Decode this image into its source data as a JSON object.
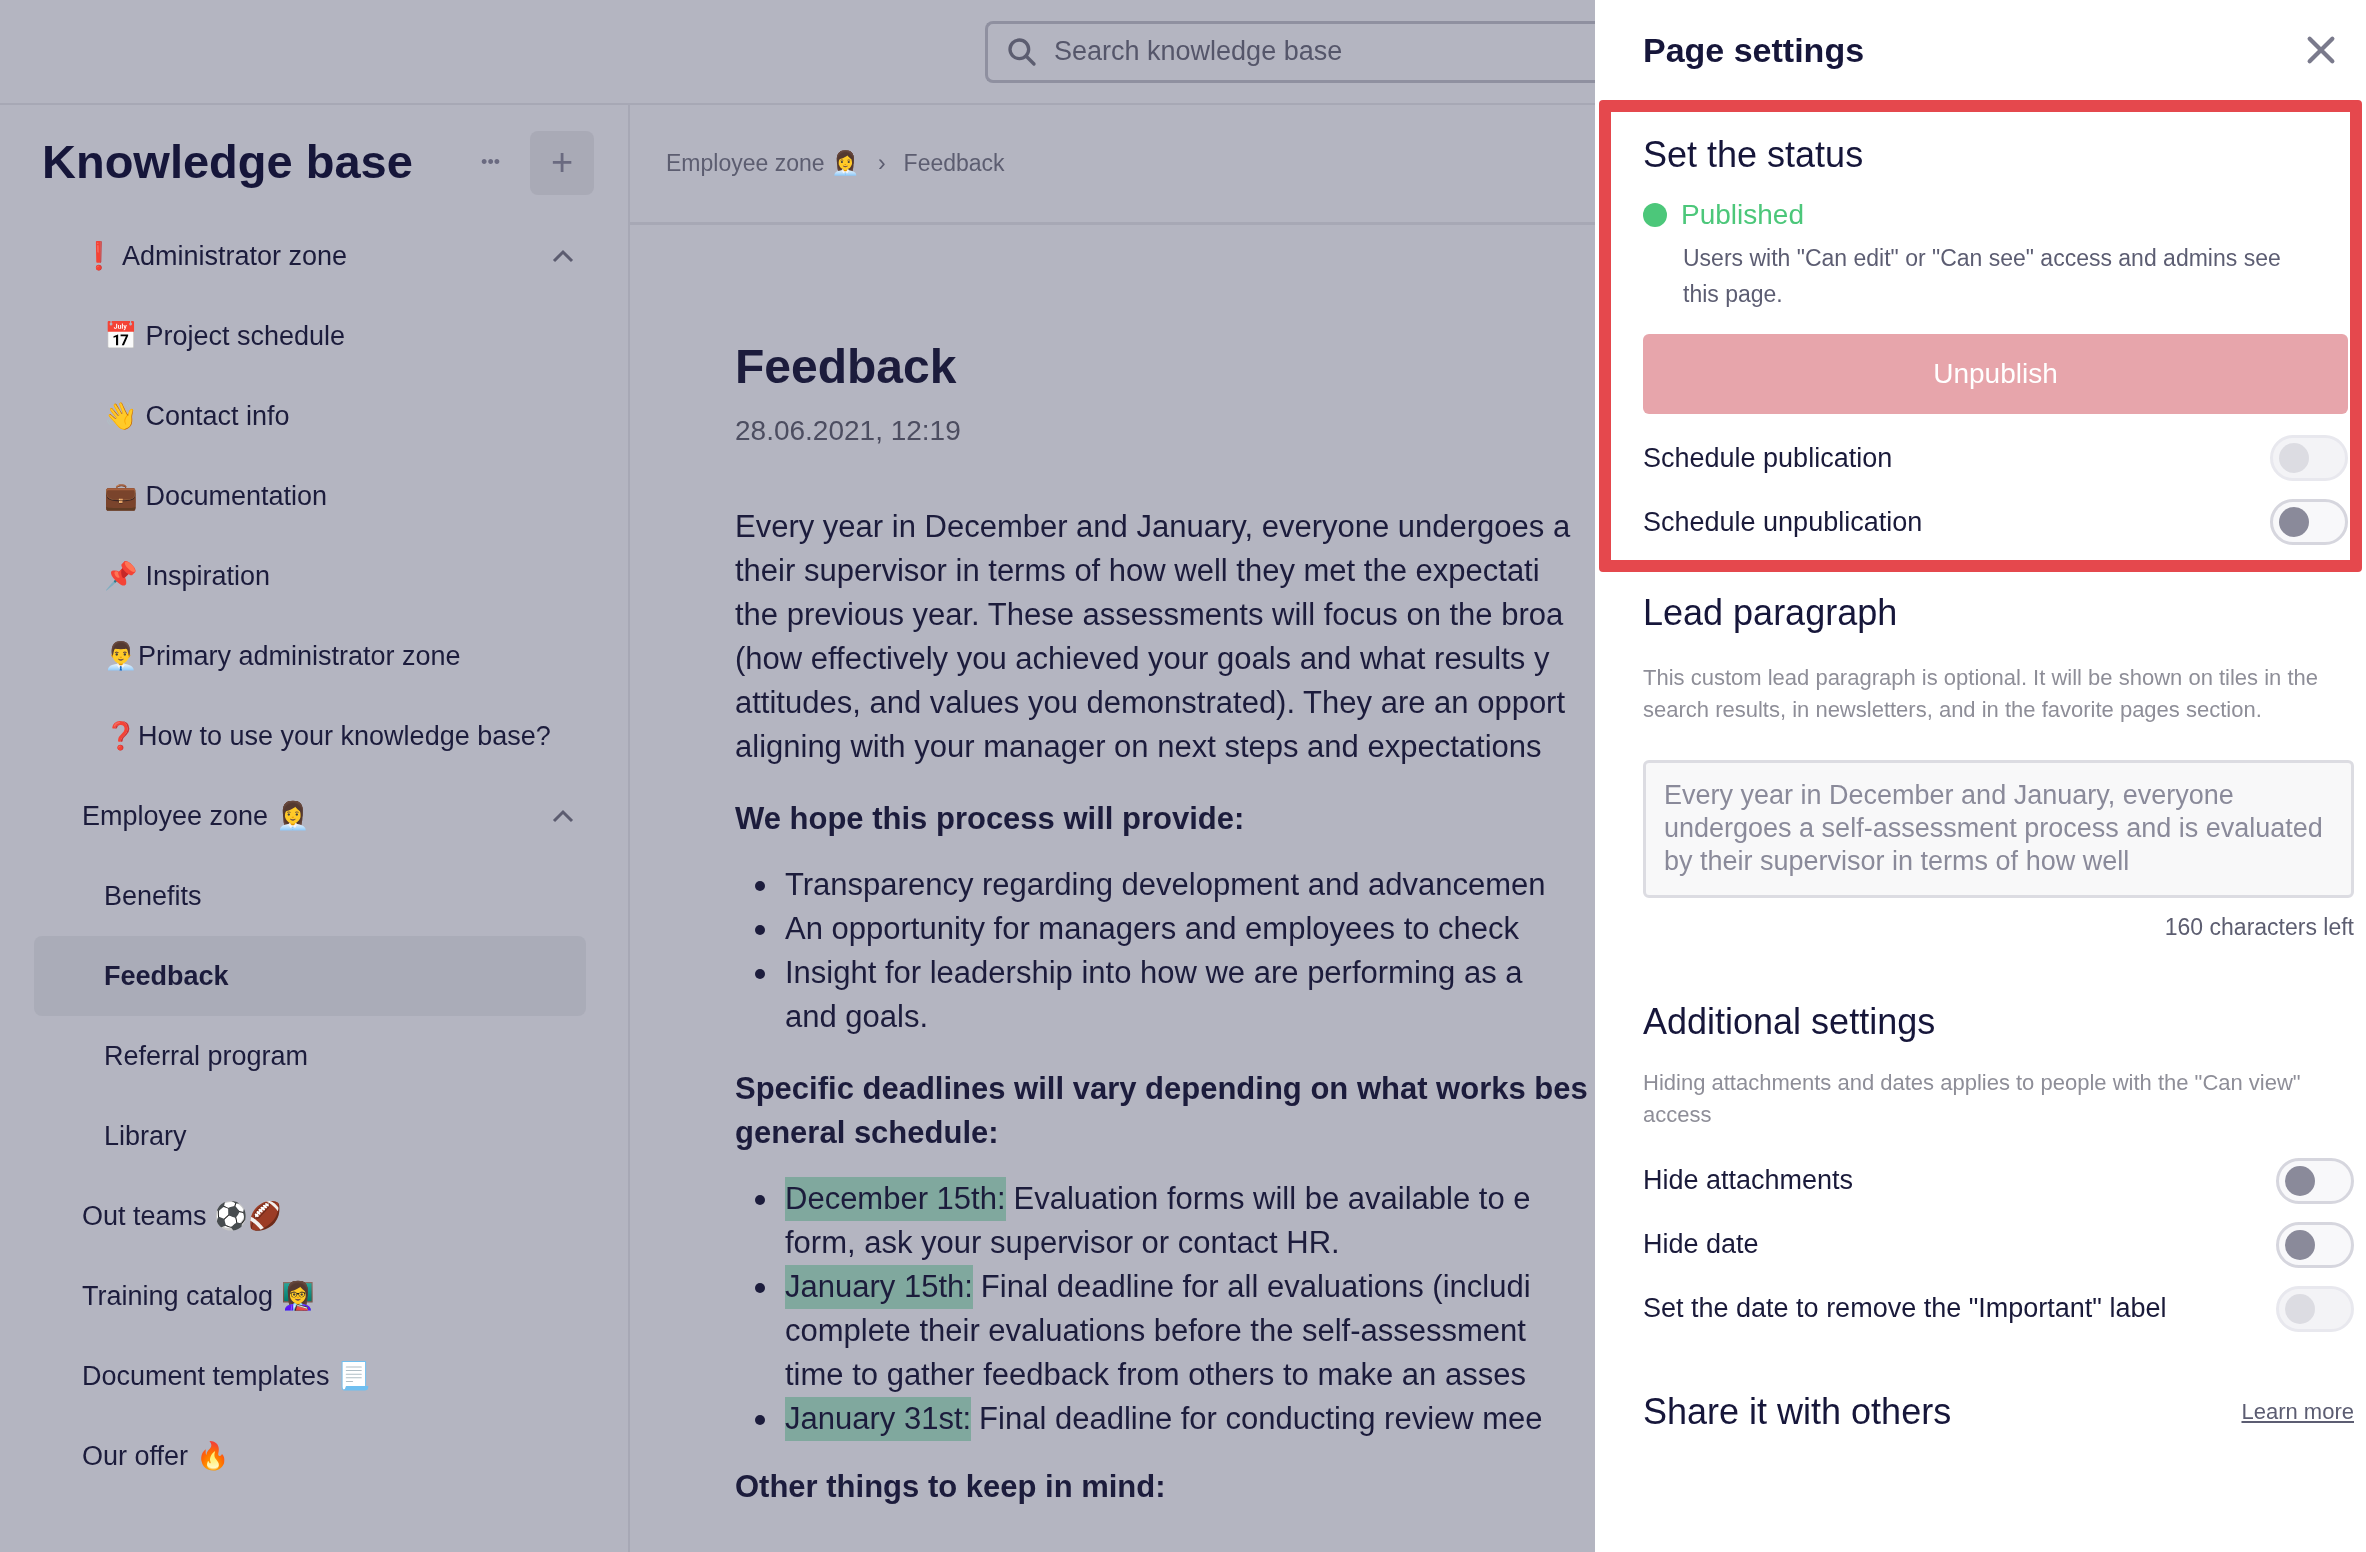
{
  "search": {
    "placeholder": "Search knowledge base"
  },
  "sidebar": {
    "title": "Knowledge base",
    "more": "•••",
    "add": "+",
    "items": [
      {
        "label": "❗ Administrator zone",
        "selected": false,
        "expanded": true,
        "children": [
          {
            "label": "📅 Project schedule",
            "selected": false
          },
          {
            "label": "👋 Contact info",
            "selected": false
          },
          {
            "label": "💼 Documentation",
            "selected": false
          },
          {
            "label": "📌 Inspiration",
            "selected": false
          },
          {
            "label": "👨‍💼Primary administrator zone",
            "selected": false
          },
          {
            "label": "❓How to use your knowledge base?",
            "selected": false
          }
        ]
      },
      {
        "label": "Employee zone 👩‍💼",
        "selected": false,
        "expanded": true,
        "children": [
          {
            "label": "Benefits",
            "selected": false
          },
          {
            "label": "Feedback",
            "selected": true
          },
          {
            "label": "Referral program",
            "selected": false
          },
          {
            "label": "Library",
            "selected": false
          }
        ]
      },
      {
        "label": "Out teams ⚽🏈",
        "selected": false
      },
      {
        "label": "Training catalog 👩‍🏫",
        "selected": false
      },
      {
        "label": "Document templates 📃",
        "selected": false
      },
      {
        "label": "Our offer 🔥",
        "selected": false
      }
    ]
  },
  "breadcrumb": [
    "Employee zone 👩‍💼",
    "Feedback"
  ],
  "breadcrumb_separator": "›",
  "page": {
    "title": "Feedback",
    "date": "28.06.2021, 12:19",
    "intro_lines": [
      "Every year in December and January, everyone undergoes a",
      "their supervisor in terms of how well they met the expectati",
      "the previous year. These assessments will focus on the broa",
      "(how effectively you achieved your goals and what results y",
      "attitudes, and values you demonstrated). They are an opport",
      "aligning with your manager on next steps and expectations"
    ],
    "hope_heading": "We hope this process will provide:",
    "hope_bullets": [
      [
        "Transparency regarding development and advancemen"
      ],
      [
        "An opportunity for managers and employees to check"
      ],
      [
        "Insight for leadership into how we are performing as a",
        "and goals."
      ]
    ],
    "deadline_heading_lines": [
      "Specific deadlines will vary depending on what works bes",
      "general schedule:"
    ],
    "deadlines": [
      {
        "date": "December 15th:",
        "lines": [
          "Evaluation forms will be available to e",
          "form, ask your supervisor or contact HR."
        ]
      },
      {
        "date": "January 15th:",
        "lines": [
          "Final deadline for all evaluations (includi",
          "complete their evaluations before the self-assessment",
          "time to gather feedback from others to make an asses"
        ]
      },
      {
        "date": "January 31st:",
        "lines": [
          "Final deadline for conducting review mee"
        ]
      }
    ],
    "other_heading": "Other things to keep in mind:"
  },
  "settings": {
    "title": "Page settings",
    "status": {
      "heading": "Set the status",
      "state": "Published",
      "color": "#4cc77a",
      "description": "Users with \"Can edit\" or \"Can see\" access and admins see this page.",
      "button": "Unpublish",
      "toggles": [
        {
          "label": "Schedule publication",
          "on": false,
          "disabled": true
        },
        {
          "label": "Schedule unpublication",
          "on": false,
          "disabled": false
        }
      ]
    },
    "lead": {
      "heading": "Lead paragraph",
      "description": "This custom lead paragraph is optional. It will be shown on tiles in the search results, in newsletters, and in the favorite pages section.",
      "value": "Every year in December and January, everyone undergoes a self-assessment process and is evaluated by their supervisor in terms of how well",
      "counter": "160 characters left"
    },
    "additional": {
      "heading": "Additional settings",
      "description": "Hiding attachments and dates applies to people with the \"Can view\" access",
      "toggles": [
        {
          "label": "Hide attachments",
          "on": false,
          "disabled": false
        },
        {
          "label": "Hide date",
          "on": false,
          "disabled": false
        },
        {
          "label": "Set the date to remove the \"Important\" label",
          "on": false,
          "disabled": true
        }
      ]
    },
    "share": {
      "heading": "Share it with others",
      "link": "Learn more"
    }
  }
}
